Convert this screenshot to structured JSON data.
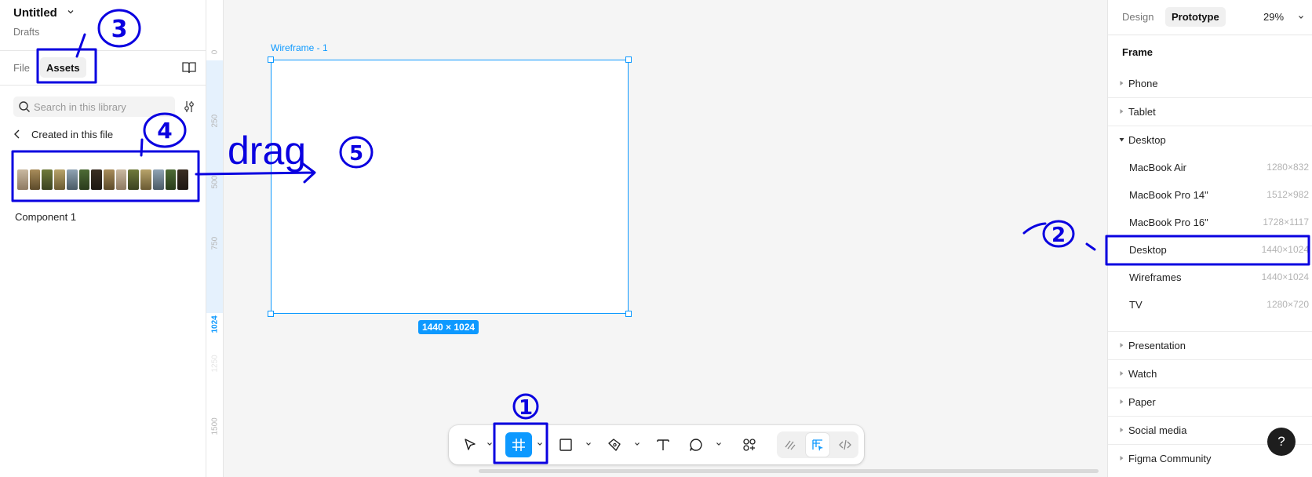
{
  "left_panel": {
    "file_title": "Untitled",
    "file_subtitle": "Drafts",
    "tabs": {
      "file": "File",
      "assets": "Assets"
    },
    "search_placeholder": "Search in this library",
    "breadcrumb": "Created in this file",
    "component_name": "Component 1"
  },
  "ruler": {
    "ticks": [
      "0",
      "250",
      "500",
      "750",
      "1024",
      "1250",
      "1500"
    ]
  },
  "canvas": {
    "frame_label": "Wireframe - 1",
    "frame_size": "1440 × 1024"
  },
  "toolbar": {
    "tools": [
      "move-tool",
      "frame-tool",
      "shape-tool",
      "pen-tool",
      "text-tool",
      "comment-tool",
      "actions-tool"
    ],
    "active_tool": "frame-tool",
    "dev_modes": [
      "draw-mode",
      "design-mode",
      "dev-mode"
    ],
    "active_dev_mode": "design-mode"
  },
  "right_panel": {
    "tabs": {
      "design": "Design",
      "prototype": "Prototype"
    },
    "active_tab": "Prototype",
    "zoom": "29%",
    "section_title": "Frame",
    "categories": [
      {
        "label": "Phone",
        "expanded": false
      },
      {
        "label": "Tablet",
        "expanded": false
      },
      {
        "label": "Desktop",
        "expanded": true
      },
      {
        "label": "Presentation",
        "expanded": false
      },
      {
        "label": "Watch",
        "expanded": false
      },
      {
        "label": "Paper",
        "expanded": false
      },
      {
        "label": "Social media",
        "expanded": false
      },
      {
        "label": "Figma Community",
        "expanded": false
      }
    ],
    "desktop_presets": [
      {
        "label": "MacBook Air",
        "dims": "1280×832"
      },
      {
        "label": "MacBook Pro 14\"",
        "dims": "1512×982"
      },
      {
        "label": "MacBook Pro 16\"",
        "dims": "1728×1117"
      },
      {
        "label": "Desktop",
        "dims": "1440×1024"
      },
      {
        "label": "Wireframes",
        "dims": "1440×1024"
      },
      {
        "label": "TV",
        "dims": "1280×720"
      }
    ],
    "help": "?"
  },
  "annotations": {
    "drag_text": "drag",
    "step_1": "1",
    "step_2": "2",
    "step_3": "3",
    "step_4": "4",
    "step_5": "5"
  },
  "colors": {
    "accent": "#0d99ff",
    "annotation": "#0a00e0",
    "panel_bg": "#ffffff",
    "canvas_bg": "#f5f5f5"
  }
}
